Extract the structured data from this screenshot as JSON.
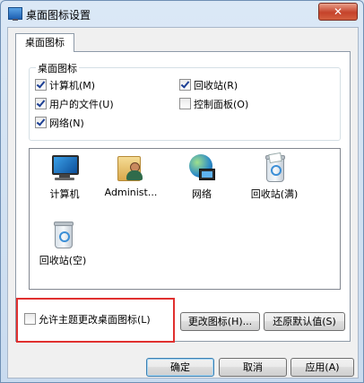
{
  "window": {
    "title": "桌面图标设置",
    "close_glyph": "✕"
  },
  "tab": {
    "label": "桌面图标"
  },
  "group": {
    "legend": "桌面图标",
    "checkboxes": [
      {
        "label": "计算机(M)",
        "checked": true
      },
      {
        "label": "回收站(R)",
        "checked": true
      },
      {
        "label": "用户的文件(U)",
        "checked": true
      },
      {
        "label": "控制面板(O)",
        "checked": false
      },
      {
        "label": "网络(N)",
        "checked": true
      }
    ]
  },
  "icons": [
    {
      "label": "计算机",
      "icon": "computer-icon"
    },
    {
      "label": "Administ...",
      "icon": "user-folder-icon"
    },
    {
      "label": "网络",
      "icon": "network-icon"
    },
    {
      "label": "回收站(满)",
      "icon": "recycle-bin-full-icon"
    },
    {
      "label": "回收站(空)",
      "icon": "recycle-bin-empty-icon"
    }
  ],
  "buttons": {
    "change_icon": "更改图标(H)...",
    "restore_default": "还原默认值(S)",
    "ok": "确定",
    "cancel": "取消",
    "apply": "应用(A)"
  },
  "allow_themes": {
    "label": "允许主题更改桌面图标(L)",
    "checked": false
  },
  "colors": {
    "highlight": "#e0302f",
    "close": "#c5432b"
  }
}
